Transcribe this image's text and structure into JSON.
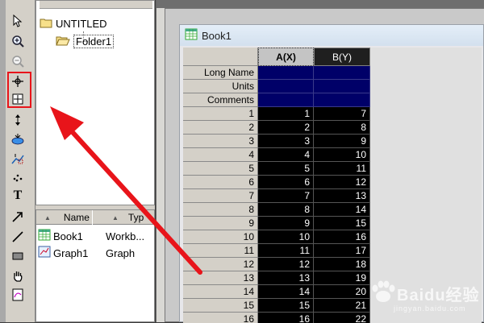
{
  "explorer": {
    "project": "UNTITLED",
    "folder": "Folder1",
    "columns": {
      "name": "Name",
      "type": "Typ"
    },
    "items": [
      {
        "name": "Book1",
        "type": "Workb..."
      },
      {
        "name": "Graph1",
        "type": "Graph"
      }
    ]
  },
  "toolbar": {
    "icons": [
      "pointer-icon",
      "zoom-in-icon",
      "zoom-out-icon",
      "data-reader-icon",
      "screen-reader-icon",
      "data-selector-icon",
      "draw-data-icon",
      "mask-icon",
      "region-icon",
      "text-tool-icon",
      "arrow-tool-icon",
      "line-tool-icon",
      "rectangle-tool-icon",
      "hand-icon",
      "function-graph-icon"
    ],
    "text_tool_glyph": "T"
  },
  "workbook": {
    "title": "Book1",
    "columns": [
      "A(X)",
      "B(Y)"
    ],
    "meta_rows": [
      "Long Name",
      "Units",
      "Comments"
    ],
    "rows": [
      {
        "index": "1",
        "a": "1",
        "b": "7"
      },
      {
        "index": "2",
        "a": "2",
        "b": "8"
      },
      {
        "index": "3",
        "a": "3",
        "b": "9"
      },
      {
        "index": "4",
        "a": "4",
        "b": "10"
      },
      {
        "index": "5",
        "a": "5",
        "b": "11"
      },
      {
        "index": "6",
        "a": "6",
        "b": "12"
      },
      {
        "index": "7",
        "a": "7",
        "b": "13"
      },
      {
        "index": "8",
        "a": "8",
        "b": "14"
      },
      {
        "index": "9",
        "a": "9",
        "b": "15"
      },
      {
        "index": "10",
        "a": "10",
        "b": "16"
      },
      {
        "index": "11",
        "a": "11",
        "b": "17"
      },
      {
        "index": "12",
        "a": "12",
        "b": "18"
      },
      {
        "index": "13",
        "a": "13",
        "b": "19"
      },
      {
        "index": "14",
        "a": "14",
        "b": "20"
      },
      {
        "index": "15",
        "a": "15",
        "b": "21"
      },
      {
        "index": "16",
        "a": "16",
        "b": "22"
      }
    ]
  },
  "watermark": {
    "text": "Baidu经验",
    "sub": "jingyan.baidu.com"
  },
  "colors": {
    "annotation": "#e8141a",
    "meta_fill": "#000068",
    "data_fill": "#000000"
  }
}
